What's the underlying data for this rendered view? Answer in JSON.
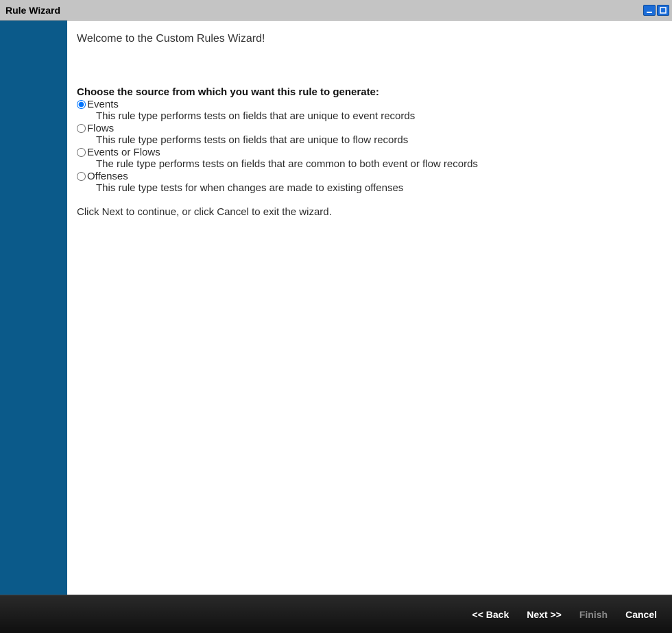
{
  "window": {
    "title": "Rule Wizard"
  },
  "content": {
    "welcome": "Welcome to the Custom Rules Wizard!",
    "instruction": "Choose the source from which you want this rule to generate:",
    "options": [
      {
        "label": "Events",
        "description": "This rule type performs tests on fields that are unique to event records",
        "selected": true
      },
      {
        "label": "Flows",
        "description": "This rule type performs tests on fields that are unique to flow records",
        "selected": false
      },
      {
        "label": "Events or Flows",
        "description": "The rule type performs tests on fields that are common to both event or flow records",
        "selected": false
      },
      {
        "label": "Offenses",
        "description": "This rule type tests for when changes are made to existing offenses",
        "selected": false
      }
    ],
    "continue": "Click Next to continue, or click Cancel to exit the wizard."
  },
  "footer": {
    "back": "<< Back",
    "next": "Next >>",
    "finish": "Finish",
    "cancel": "Cancel"
  }
}
